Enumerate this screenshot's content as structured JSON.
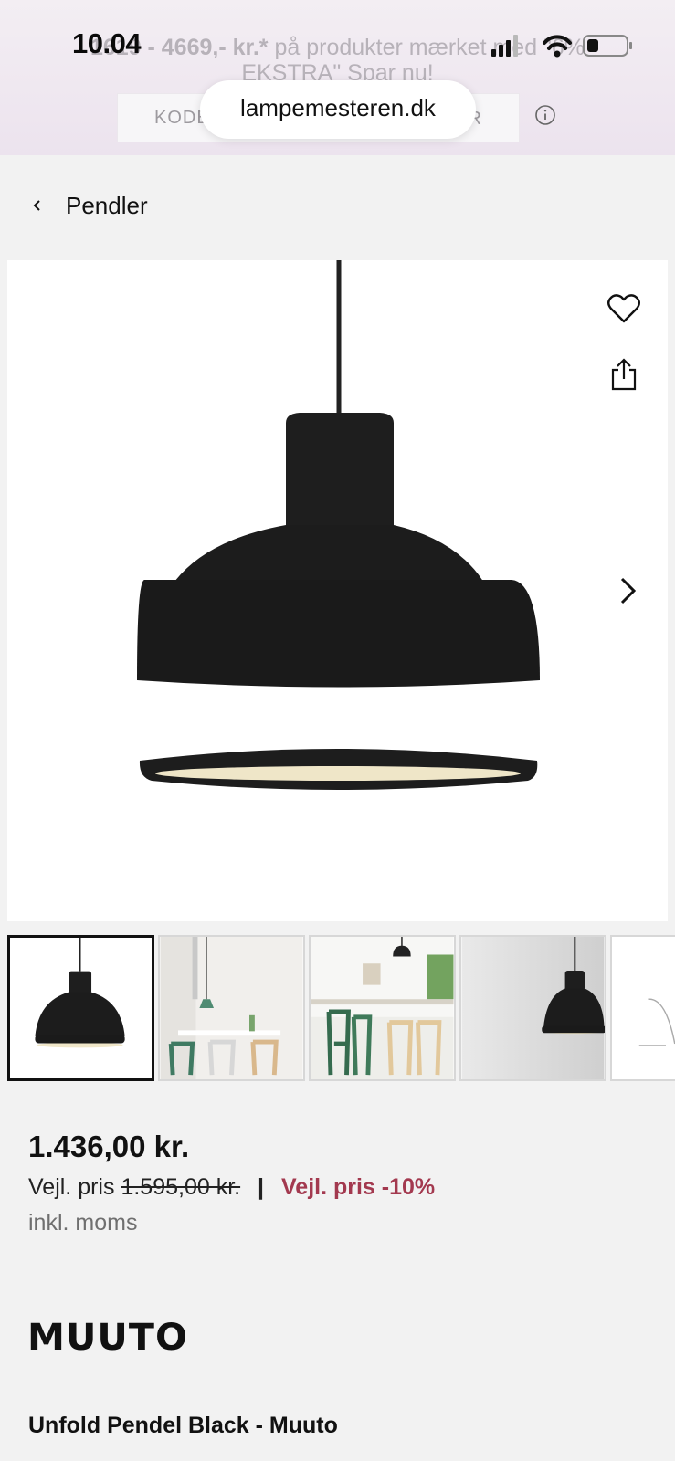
{
  "status_bar": {
    "time": "10.04",
    "icons": [
      "cellular-signal-icon",
      "wifi-icon",
      "battery-icon"
    ]
  },
  "banner": {
    "line1_bold": "1619 - 4669,- kr.*",
    "line1_rest": " på produkter mærket med \"6%",
    "line2": "EKSTRA\"  Spar nu!",
    "code_left": "KODE:",
    "code_right": "R",
    "info_icon": "info-icon"
  },
  "browser": {
    "url": "lampemesteren.dk"
  },
  "breadcrumb": {
    "back_icon": "chevron-left-icon",
    "label": "Pendler"
  },
  "gallery": {
    "actions": [
      "heart-icon",
      "share-icon",
      "chevron-right-icon"
    ],
    "thumbnails": [
      "lamp-product",
      "dining-room",
      "kitchen-bar",
      "lamp-grey",
      "lamp-outline"
    ],
    "active_index": 0
  },
  "pricing": {
    "price": "1.436,00 kr.",
    "rrp_label": "Vejl. pris",
    "rrp_old": "1.595,00 kr.",
    "separator": "|",
    "discount": "Vejl. pris -10%",
    "vat_note": "inkl. moms"
  },
  "brand": {
    "logo_text": "MUUTO"
  },
  "product": {
    "title": "Unfold Pendel Black - Muuto"
  },
  "colors": {
    "accent": "#a3394f",
    "banner_bg": "#ece3ee",
    "page_bg": "#f2f2f2"
  }
}
